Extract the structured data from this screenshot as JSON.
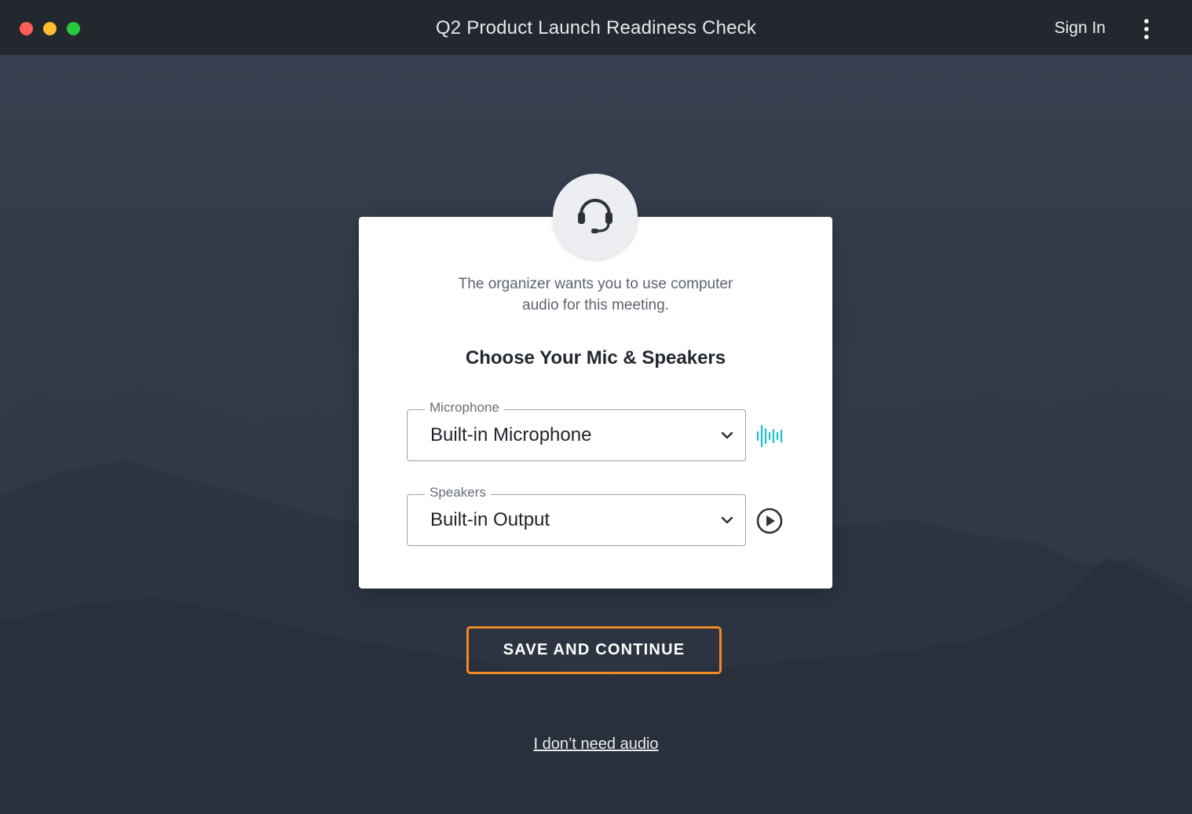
{
  "window": {
    "title": "Q2 Product Launch Readiness Check",
    "sign_in_label": "Sign In"
  },
  "dialog": {
    "description": "The organizer wants you to use computer audio for this meeting.",
    "heading": "Choose Your Mic & Speakers",
    "microphone": {
      "legend": "Microphone",
      "value": "Built-in Microphone"
    },
    "speakers": {
      "legend": "Speakers",
      "value": "Built-in Output"
    }
  },
  "actions": {
    "save_label": "SAVE AND CONTINUE",
    "no_audio_label": "I don’t need audio"
  },
  "icons": {
    "avatar": "headset-icon",
    "mic_level": "audio-level-icon",
    "speaker_test": "play-circle-icon",
    "menu": "kebab-menu-icon"
  },
  "colors": {
    "accent_orange": "#f08a24",
    "mic_level_teal": "#19c3c8"
  }
}
